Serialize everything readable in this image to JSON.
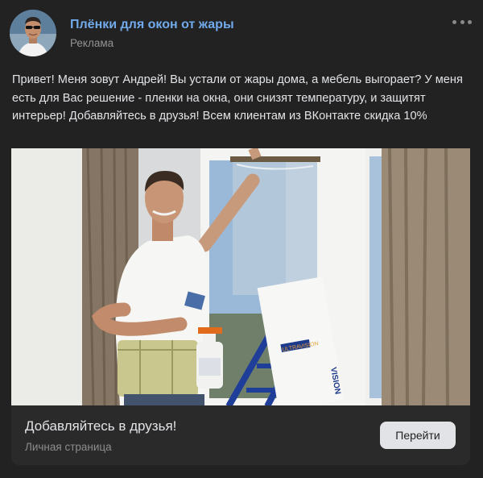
{
  "post": {
    "author": "Плёнки для окон от жары",
    "label": "Реклама",
    "text": "Привет! Меня зовут Андрей! Вы устали от жары дома, а мебель выгорает? У меня есть для Вас решение - пленки на окна, они снизят температуру, и защитят интерьер! Добавляйтесь в друзья! Всем клиентам из ВКонтакте скидка 10%",
    "more_icon": "more-horizontal-icon"
  },
  "media": {
    "box_brand": "ULTRAVISION",
    "box_side": "VISION"
  },
  "snippet": {
    "title": "Добавляйтесь в друзья!",
    "subtitle": "Личная страница",
    "button_label": "Перейти"
  },
  "colors": {
    "background": "#222222",
    "link": "#71aaeb",
    "button_bg": "#e1e3e6"
  }
}
